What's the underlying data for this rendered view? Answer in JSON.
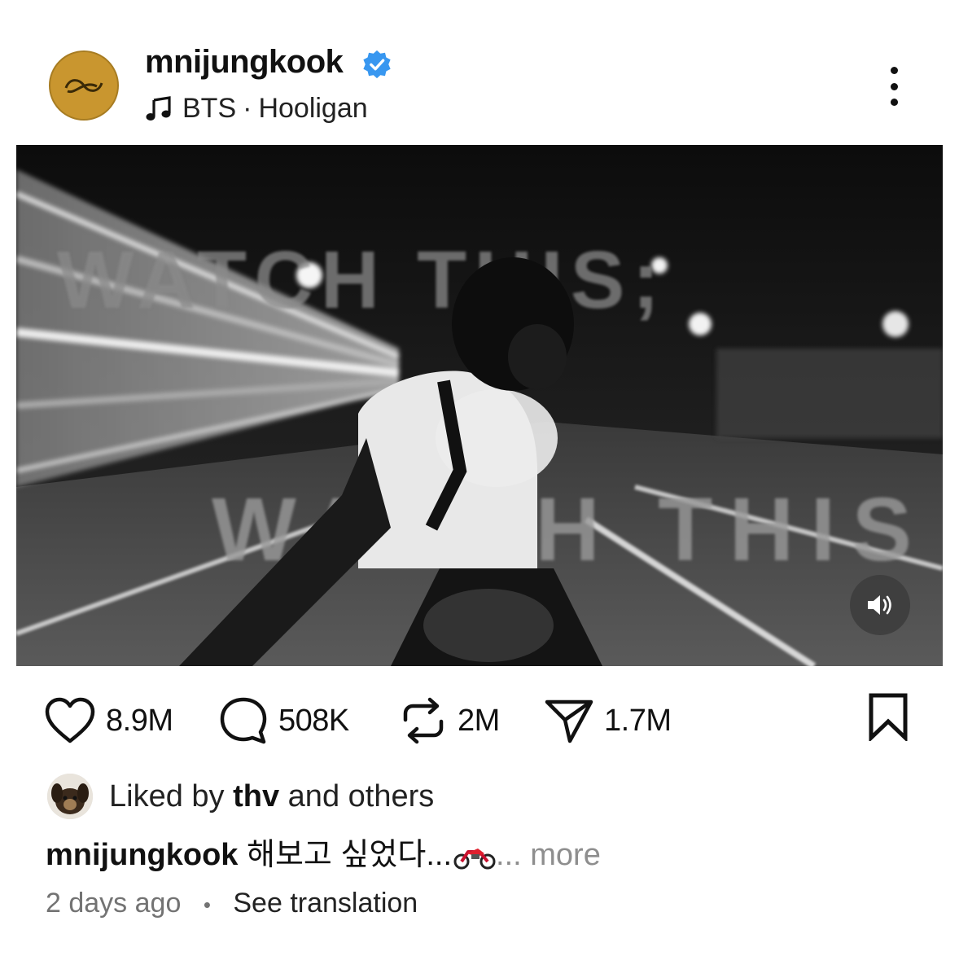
{
  "post": {
    "username": "mnijungkook",
    "verified": true,
    "audio": {
      "icon": "music-note-icon",
      "artist": "BTS",
      "separator": "·",
      "track": "Hooligan"
    }
  },
  "media": {
    "overlay_text_top": "WATCH THIS;",
    "overlay_text_bottom": "WATCH THIS",
    "mute_icon": "speaker-icon"
  },
  "actions": {
    "likes": "8.9M",
    "comments": "508K",
    "reposts": "2M",
    "shares": "1.7M"
  },
  "liked_by": {
    "prefix": "Liked by",
    "user": "thv",
    "suffix": "and others"
  },
  "caption": {
    "username": "mnijungkook",
    "text": "해보고 싶었다...",
    "emoji": "motorcycle-icon",
    "ellipsis": "...",
    "more": "more"
  },
  "meta": {
    "time": "2 days ago",
    "dot": "•",
    "translation": "See translation"
  },
  "colors": {
    "verified": "#3897f0",
    "avatar": "#c9962f",
    "muted_text": "#737373"
  }
}
